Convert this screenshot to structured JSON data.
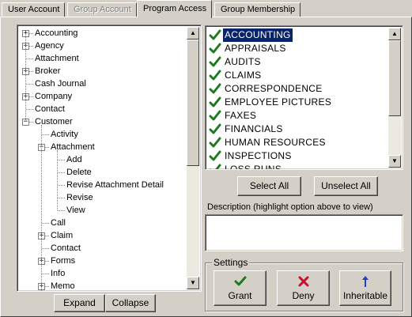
{
  "tabs": [
    {
      "label": "User Account",
      "state": "normal"
    },
    {
      "label": "Group Account",
      "state": "disabled"
    },
    {
      "label": "Program Access",
      "state": "active"
    },
    {
      "label": "Group Membership",
      "state": "normal"
    }
  ],
  "tree": [
    {
      "label": "Accounting",
      "level": 0,
      "expander": "+"
    },
    {
      "label": "Agency",
      "level": 0,
      "expander": "+"
    },
    {
      "label": "Attachment",
      "level": 0,
      "expander": ""
    },
    {
      "label": "Broker",
      "level": 0,
      "expander": "+"
    },
    {
      "label": "Cash Journal",
      "level": 0,
      "expander": ""
    },
    {
      "label": "Company",
      "level": 0,
      "expander": "+"
    },
    {
      "label": "Contact",
      "level": 0,
      "expander": ""
    },
    {
      "label": "Customer",
      "level": 0,
      "expander": "-"
    },
    {
      "label": "Activity",
      "level": 1,
      "expander": ""
    },
    {
      "label": "Attachment",
      "level": 1,
      "expander": "-"
    },
    {
      "label": "Add",
      "level": 2,
      "expander": ""
    },
    {
      "label": "Delete",
      "level": 2,
      "expander": ""
    },
    {
      "label": "Revise Attachment Detail",
      "level": 2,
      "expander": ""
    },
    {
      "label": "Revise",
      "level": 2,
      "expander": ""
    },
    {
      "label": "View",
      "level": 2,
      "expander": ""
    },
    {
      "label": "Call",
      "level": 1,
      "expander": ""
    },
    {
      "label": "Claim",
      "level": 1,
      "expander": "+"
    },
    {
      "label": "Contact",
      "level": 1,
      "expander": ""
    },
    {
      "label": "Forms",
      "level": 1,
      "expander": "+"
    },
    {
      "label": "Info",
      "level": 1,
      "expander": ""
    },
    {
      "label": "Memo",
      "level": 1,
      "expander": "+"
    }
  ],
  "options": [
    {
      "label": "ACCOUNTING",
      "checked": true,
      "selected": true
    },
    {
      "label": "APPRAISALS",
      "checked": true,
      "selected": false
    },
    {
      "label": "AUDITS",
      "checked": true,
      "selected": false
    },
    {
      "label": "CLAIMS",
      "checked": true,
      "selected": false
    },
    {
      "label": "CORRESPONDENCE",
      "checked": true,
      "selected": false
    },
    {
      "label": "EMPLOYEE PICTURES",
      "checked": true,
      "selected": false
    },
    {
      "label": "FAXES",
      "checked": true,
      "selected": false
    },
    {
      "label": "FINANCIALS",
      "checked": true,
      "selected": false
    },
    {
      "label": "HUMAN RESOURCES",
      "checked": true,
      "selected": false
    },
    {
      "label": "INSPECTIONS",
      "checked": true,
      "selected": false
    },
    {
      "label": "LOSS RUNS",
      "checked": true,
      "selected": false
    }
  ],
  "buttons": {
    "expand": "Expand",
    "collapse": "Collapse",
    "select_all": "Select All",
    "unselect_all": "Unselect All"
  },
  "description": {
    "label": "Description (highlight option above to view)",
    "value": ""
  },
  "settings": {
    "title": "Settings",
    "grant": {
      "label": "Grant",
      "icon": "green-check-icon"
    },
    "deny": {
      "label": "Deny",
      "icon": "red-x-icon"
    },
    "inheritable": {
      "label": "Inheritable",
      "icon": "blue-up-arrow-icon"
    }
  },
  "colors": {
    "selection": "#0a246a",
    "check": "#1e7a1e",
    "deny": "#c8102e",
    "inherit": "#1c3fc8"
  }
}
